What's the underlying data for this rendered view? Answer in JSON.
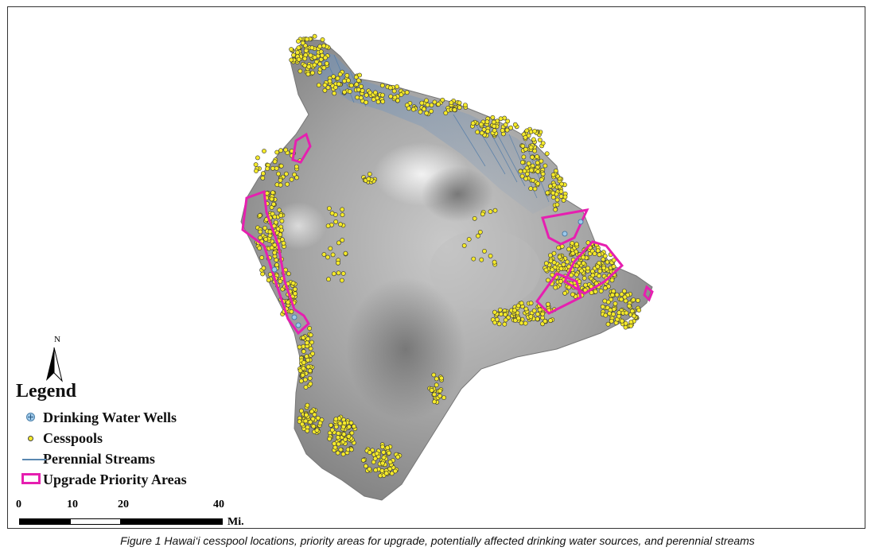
{
  "map": {
    "north_label": "N",
    "legend": {
      "title": "Legend",
      "items": [
        {
          "label": "Drinking Water Wells",
          "icon": "drinking-water-well-icon",
          "color": "#9ec9ea"
        },
        {
          "label": "Cesspools",
          "icon": "cesspool-dot-icon",
          "color": "#f5ea2a"
        },
        {
          "label": "Perennial Streams",
          "icon": "stream-line-icon",
          "color": "#5a87b0"
        },
        {
          "label": "Upgrade Priority Areas",
          "icon": "priority-area-box-icon",
          "color": "#e61fb0"
        }
      ]
    },
    "scale": {
      "ticks": [
        "0",
        "10",
        "20",
        "40"
      ],
      "unit": "Mi."
    }
  },
  "caption": "Figure 1 Hawai‘i cesspool locations, priority areas for upgrade, potentially affected drinking water sources, and perennial streams"
}
